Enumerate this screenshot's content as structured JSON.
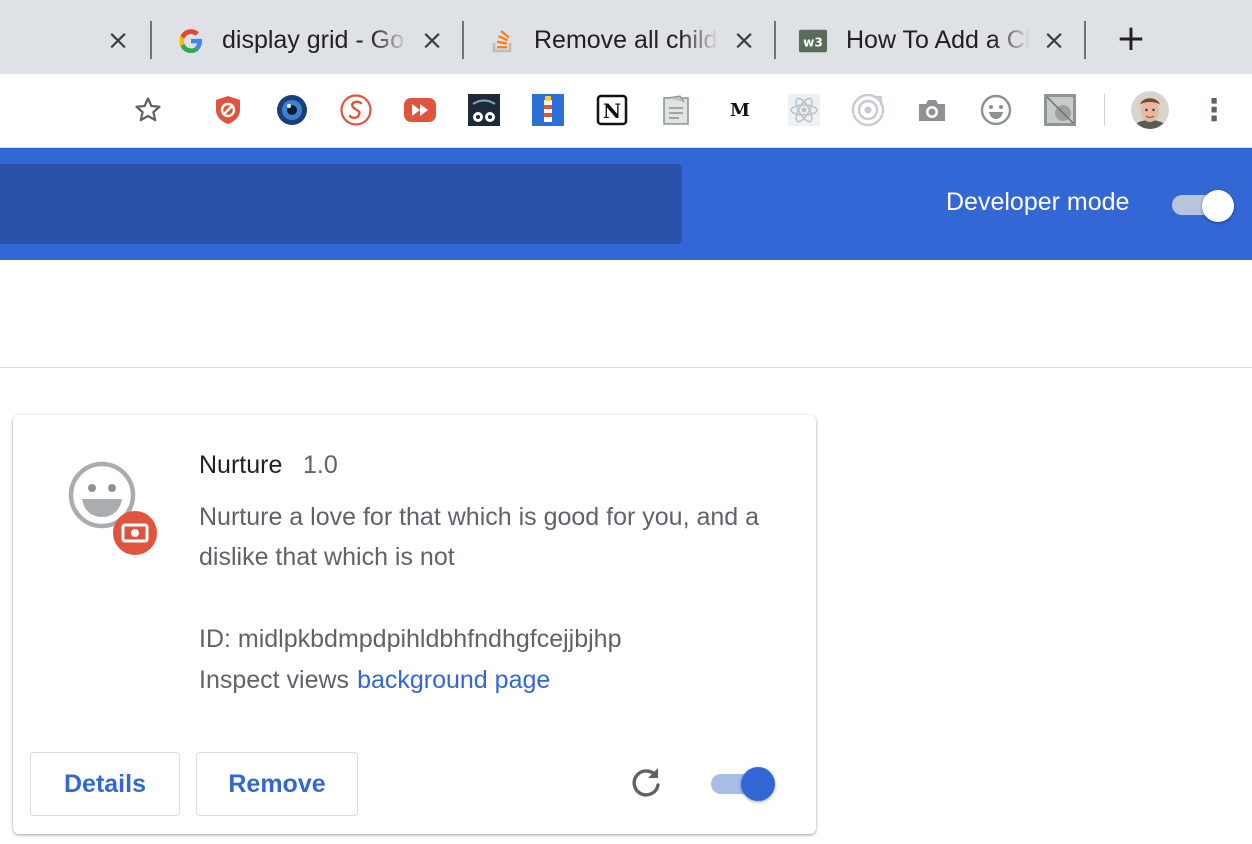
{
  "tabs": [
    {
      "title": "",
      "favicon": "previous-tab-close-only"
    },
    {
      "title": "display grid - Go",
      "favicon": "google-g-icon"
    },
    {
      "title": "Remove all child",
      "favicon": "stackoverflow-icon"
    },
    {
      "title": "How To Add a Ch",
      "favicon": "w3schools-icon"
    }
  ],
  "new_tab_label": "+",
  "toolbar": {
    "icons": [
      "star-icon",
      "ublock-icon",
      "eye-extension-icon",
      "scribble-extension-icon",
      "video-speed-icon",
      "cartoon-extension-icon",
      "lighthouse-icon",
      "notion-icon",
      "note-extension-icon",
      "medium-icon",
      "react-devtools-icon",
      "target-extension-icon",
      "camera-icon",
      "smiley-extension-icon",
      "grid-extension-icon",
      "avatar",
      "menu-icon"
    ],
    "medium_letter": "M",
    "notion_letter": "N",
    "menu_glyph": "⋮"
  },
  "header": {
    "developer_mode_label": "Developer mode",
    "developer_mode_on": true,
    "accent_color": "#3367d6"
  },
  "extension": {
    "name": "Nurture",
    "version": "1.0",
    "description": "Nurture a love for that which is good for you, and a dislike that which is not",
    "id_line": "ID: midlpkbdmpdpihldbhfndhgfcejjbjhp",
    "inspect_label": "Inspect views",
    "inspect_link": "background page",
    "details_button": "Details",
    "remove_button": "Remove",
    "enabled": true
  }
}
